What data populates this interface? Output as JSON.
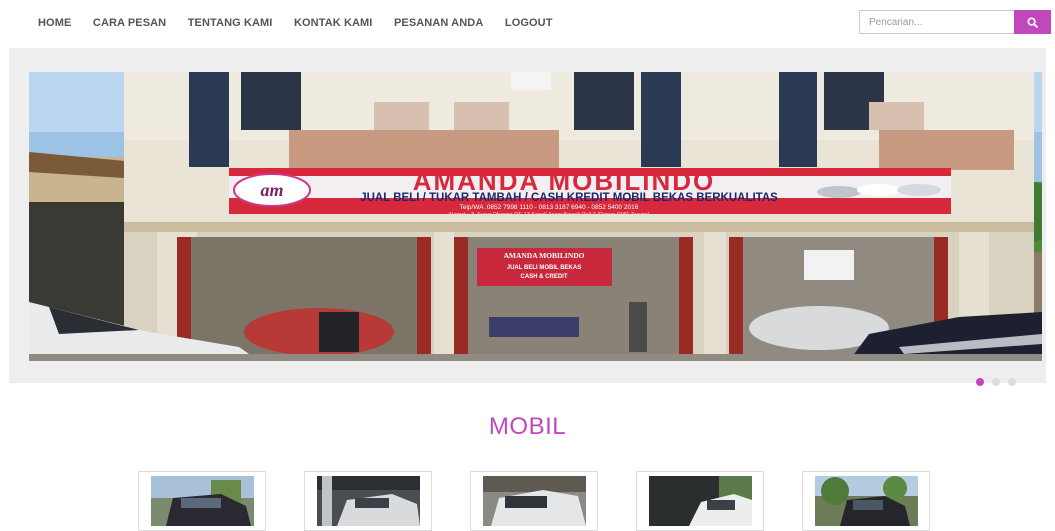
{
  "nav": {
    "items": [
      {
        "label": "HOME"
      },
      {
        "label": "CARA PESAN"
      },
      {
        "label": "TENTANG KAMI"
      },
      {
        "label": "KONTAK KAMI"
      },
      {
        "label": "PESANAN ANDA"
      },
      {
        "label": "LOGOUT"
      }
    ]
  },
  "search": {
    "placeholder": "Pencarian...",
    "button_icon": "search-icon"
  },
  "slider": {
    "sign_title": "AMANDA MOBILINDO",
    "sign_logo": "am",
    "sign_subtitle": "JUAL BELI / TUKAR TAMBAH / CASH KREDIT MOBIL BEKAS BERKUALITAS",
    "sign_phone": "Telp/WA .0852 7998 1110 - 0813 3187 6940 - 0852 5400 2016",
    "sign_address": "Alamat : Jl. Surya Dharma RT. 13 Kenali Asam Bawah Pall 7 (Depan SMP. Taruna)",
    "inner_sign_title": "AMANDA MOBILINDO",
    "inner_sign_line1": "JUAL BELI MOBIL BEKAS",
    "inner_sign_line2": "CASH & CREDIT",
    "dots": 3,
    "active_dot": 0
  },
  "section": {
    "title": "MOBIL"
  },
  "cars": [
    {
      "name": "car-1"
    },
    {
      "name": "car-2"
    },
    {
      "name": "car-3"
    },
    {
      "name": "car-4"
    },
    {
      "name": "car-5"
    }
  ],
  "colors": {
    "accent": "#c147bd",
    "nav_text": "#555555",
    "band": "#eeeeee",
    "sign_red": "#d8283c"
  }
}
